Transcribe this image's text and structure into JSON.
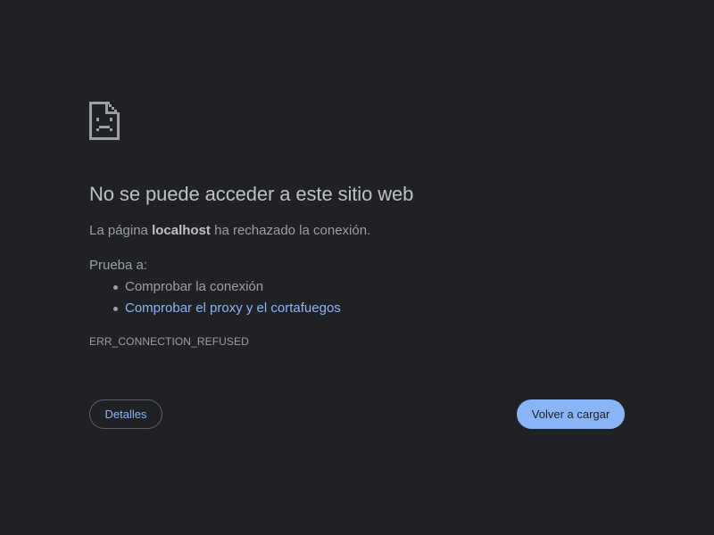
{
  "error": {
    "title": "No se puede acceder a este sitio web",
    "message_prefix": "La página ",
    "host": "localhost",
    "message_suffix": " ha rechazado la conexión.",
    "try_label": "Prueba a:",
    "suggestions": [
      "Comprobar la conexión",
      "Comprobar el proxy y el cortafuegos"
    ],
    "code": "ERR_CONNECTION_REFUSED",
    "icon": "sad-page-icon"
  },
  "buttons": {
    "details_label": "Detalles",
    "reload_label": "Volver a cargar"
  },
  "colors": {
    "background": "#202124",
    "text": "#9aa0a6",
    "heading": "#bdc1c6",
    "link": "#8ab4f8",
    "primary_button": "#8ab4f8"
  }
}
